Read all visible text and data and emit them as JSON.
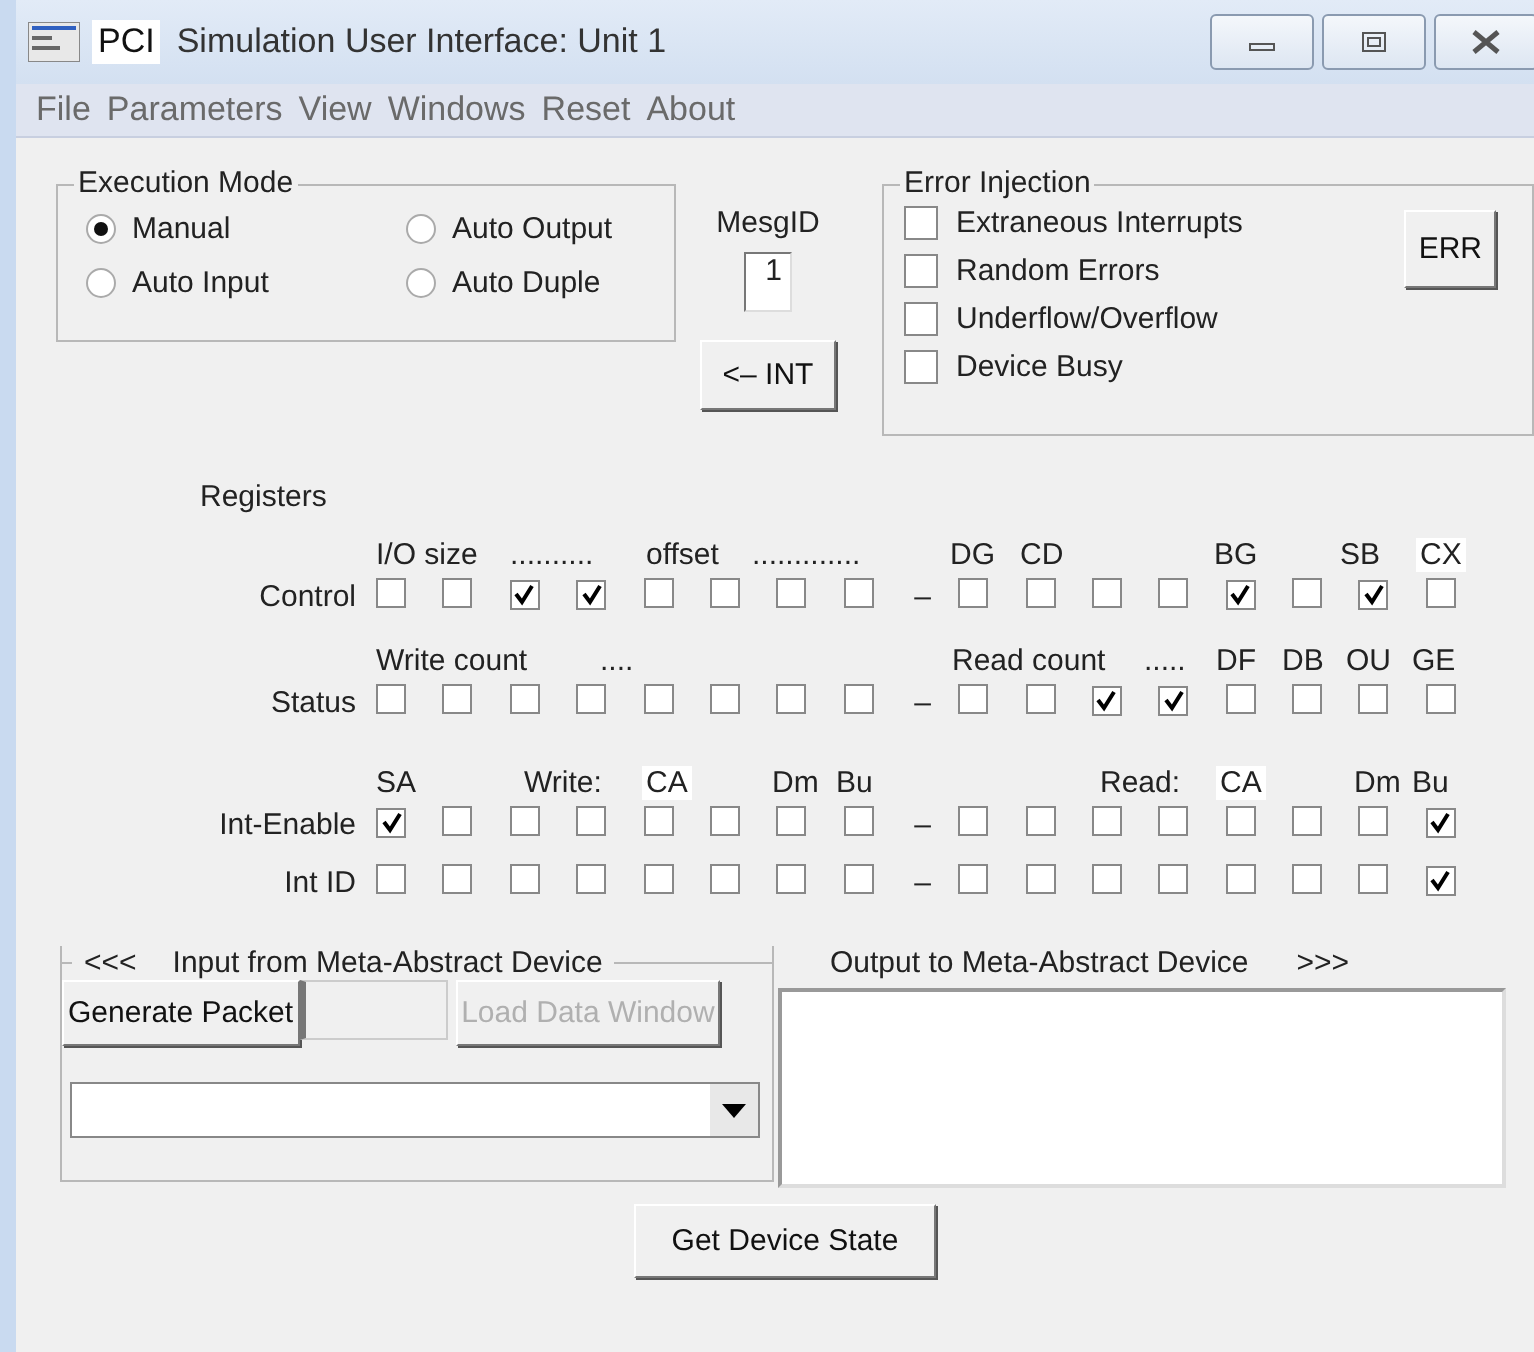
{
  "window": {
    "title_tag": "PCI",
    "title": "Simulation User Interface: Unit 1"
  },
  "menu": [
    "File",
    "Parameters",
    "View",
    "Windows",
    "Reset",
    "About"
  ],
  "execution_mode": {
    "title": "Execution Mode",
    "options": [
      {
        "label": "Manual",
        "selected": true
      },
      {
        "label": "Auto Output",
        "selected": false
      },
      {
        "label": "Auto Input",
        "selected": false
      },
      {
        "label": "Auto Duple",
        "selected": false
      }
    ]
  },
  "mesg_id": {
    "label": "MesgID",
    "value": "1"
  },
  "int_button": "<– INT",
  "error_injection": {
    "title": "Error Injection",
    "options": [
      {
        "label": "Extraneous Interrupts",
        "checked": false
      },
      {
        "label": "Random Errors",
        "checked": false
      },
      {
        "label": "Underflow/Overflow",
        "checked": false
      },
      {
        "label": "Device Busy",
        "checked": false
      }
    ],
    "button": "ERR"
  },
  "registers": {
    "title": "Registers",
    "separator": "–",
    "rows": [
      {
        "name": "Control",
        "labels": [
          {
            "text": "I/O size",
            "boxed": false
          },
          {
            "text": "..........",
            "boxed": false
          },
          {
            "text": "offset",
            "boxed": false
          },
          {
            "text": ".............",
            "boxed": false
          },
          {
            "text": "DG",
            "boxed": false
          },
          {
            "text": "CD",
            "boxed": false
          },
          {
            "text": "BG",
            "boxed": false
          },
          {
            "text": "SB",
            "boxed": false
          },
          {
            "text": "CX",
            "boxed": true
          }
        ],
        "bits": [
          {
            "checked": false
          },
          {
            "checked": false
          },
          {
            "checked": true
          },
          {
            "checked": true
          },
          {
            "checked": false
          },
          {
            "checked": false
          },
          {
            "checked": false
          },
          {
            "checked": false
          },
          {
            "checked": false
          },
          {
            "checked": false
          },
          {
            "checked": false
          },
          {
            "checked": false
          },
          {
            "checked": true
          },
          {
            "checked": false
          },
          {
            "checked": true
          },
          {
            "checked": false
          }
        ]
      },
      {
        "name": "Status",
        "labels": [
          {
            "text": "Write count",
            "boxed": false
          },
          {
            "text": "....",
            "boxed": false
          },
          {
            "text": "Read count",
            "boxed": false
          },
          {
            "text": ".....",
            "boxed": false
          },
          {
            "text": "DF",
            "boxed": false
          },
          {
            "text": "DB",
            "boxed": false
          },
          {
            "text": "OU",
            "boxed": false
          },
          {
            "text": "GE",
            "boxed": false
          }
        ],
        "bits": [
          {
            "checked": false
          },
          {
            "checked": false
          },
          {
            "checked": false
          },
          {
            "checked": false
          },
          {
            "checked": false
          },
          {
            "checked": false
          },
          {
            "checked": false
          },
          {
            "checked": false
          },
          {
            "checked": false
          },
          {
            "checked": false
          },
          {
            "checked": true
          },
          {
            "checked": true
          },
          {
            "checked": false
          },
          {
            "checked": false
          },
          {
            "checked": false
          },
          {
            "checked": false
          }
        ]
      },
      {
        "name": "Int-Enable",
        "labels": [
          {
            "text": "SA",
            "boxed": false
          },
          {
            "text": "Write:",
            "boxed": false
          },
          {
            "text": "CA",
            "boxed": true
          },
          {
            "text": "Dm",
            "boxed": false
          },
          {
            "text": "Bu",
            "boxed": false
          },
          {
            "text": "Read:",
            "boxed": false
          },
          {
            "text": "CA",
            "boxed": true
          },
          {
            "text": "Dm",
            "boxed": false
          },
          {
            "text": "Bu",
            "boxed": false
          }
        ],
        "bits": [
          {
            "checked": true
          },
          {
            "checked": false
          },
          {
            "checked": false
          },
          {
            "checked": false
          },
          {
            "checked": false
          },
          {
            "checked": false
          },
          {
            "checked": false
          },
          {
            "checked": false
          },
          {
            "checked": false
          },
          {
            "checked": false
          },
          {
            "checked": false
          },
          {
            "checked": false
          },
          {
            "checked": false
          },
          {
            "checked": false
          },
          {
            "checked": false
          },
          {
            "checked": true
          }
        ]
      },
      {
        "name": "Int ID",
        "labels": [],
        "bits": [
          {
            "checked": false
          },
          {
            "checked": false
          },
          {
            "checked": false
          },
          {
            "checked": false
          },
          {
            "checked": false
          },
          {
            "checked": false
          },
          {
            "checked": false
          },
          {
            "checked": false
          },
          {
            "checked": false
          },
          {
            "checked": false
          },
          {
            "checked": false
          },
          {
            "checked": false
          },
          {
            "checked": false
          },
          {
            "checked": false
          },
          {
            "checked": false
          },
          {
            "checked": true
          }
        ]
      }
    ]
  },
  "input_group": {
    "arrows": "<<<",
    "title": "Input from Meta-Abstract Device",
    "generate_button": "Generate Packet",
    "load_button": {
      "label": "Load Data Window",
      "disabled": true
    }
  },
  "output_group": {
    "title": "Output to Meta-Abstract Device",
    "arrows": ">>>"
  },
  "state_button": "Get Device State"
}
